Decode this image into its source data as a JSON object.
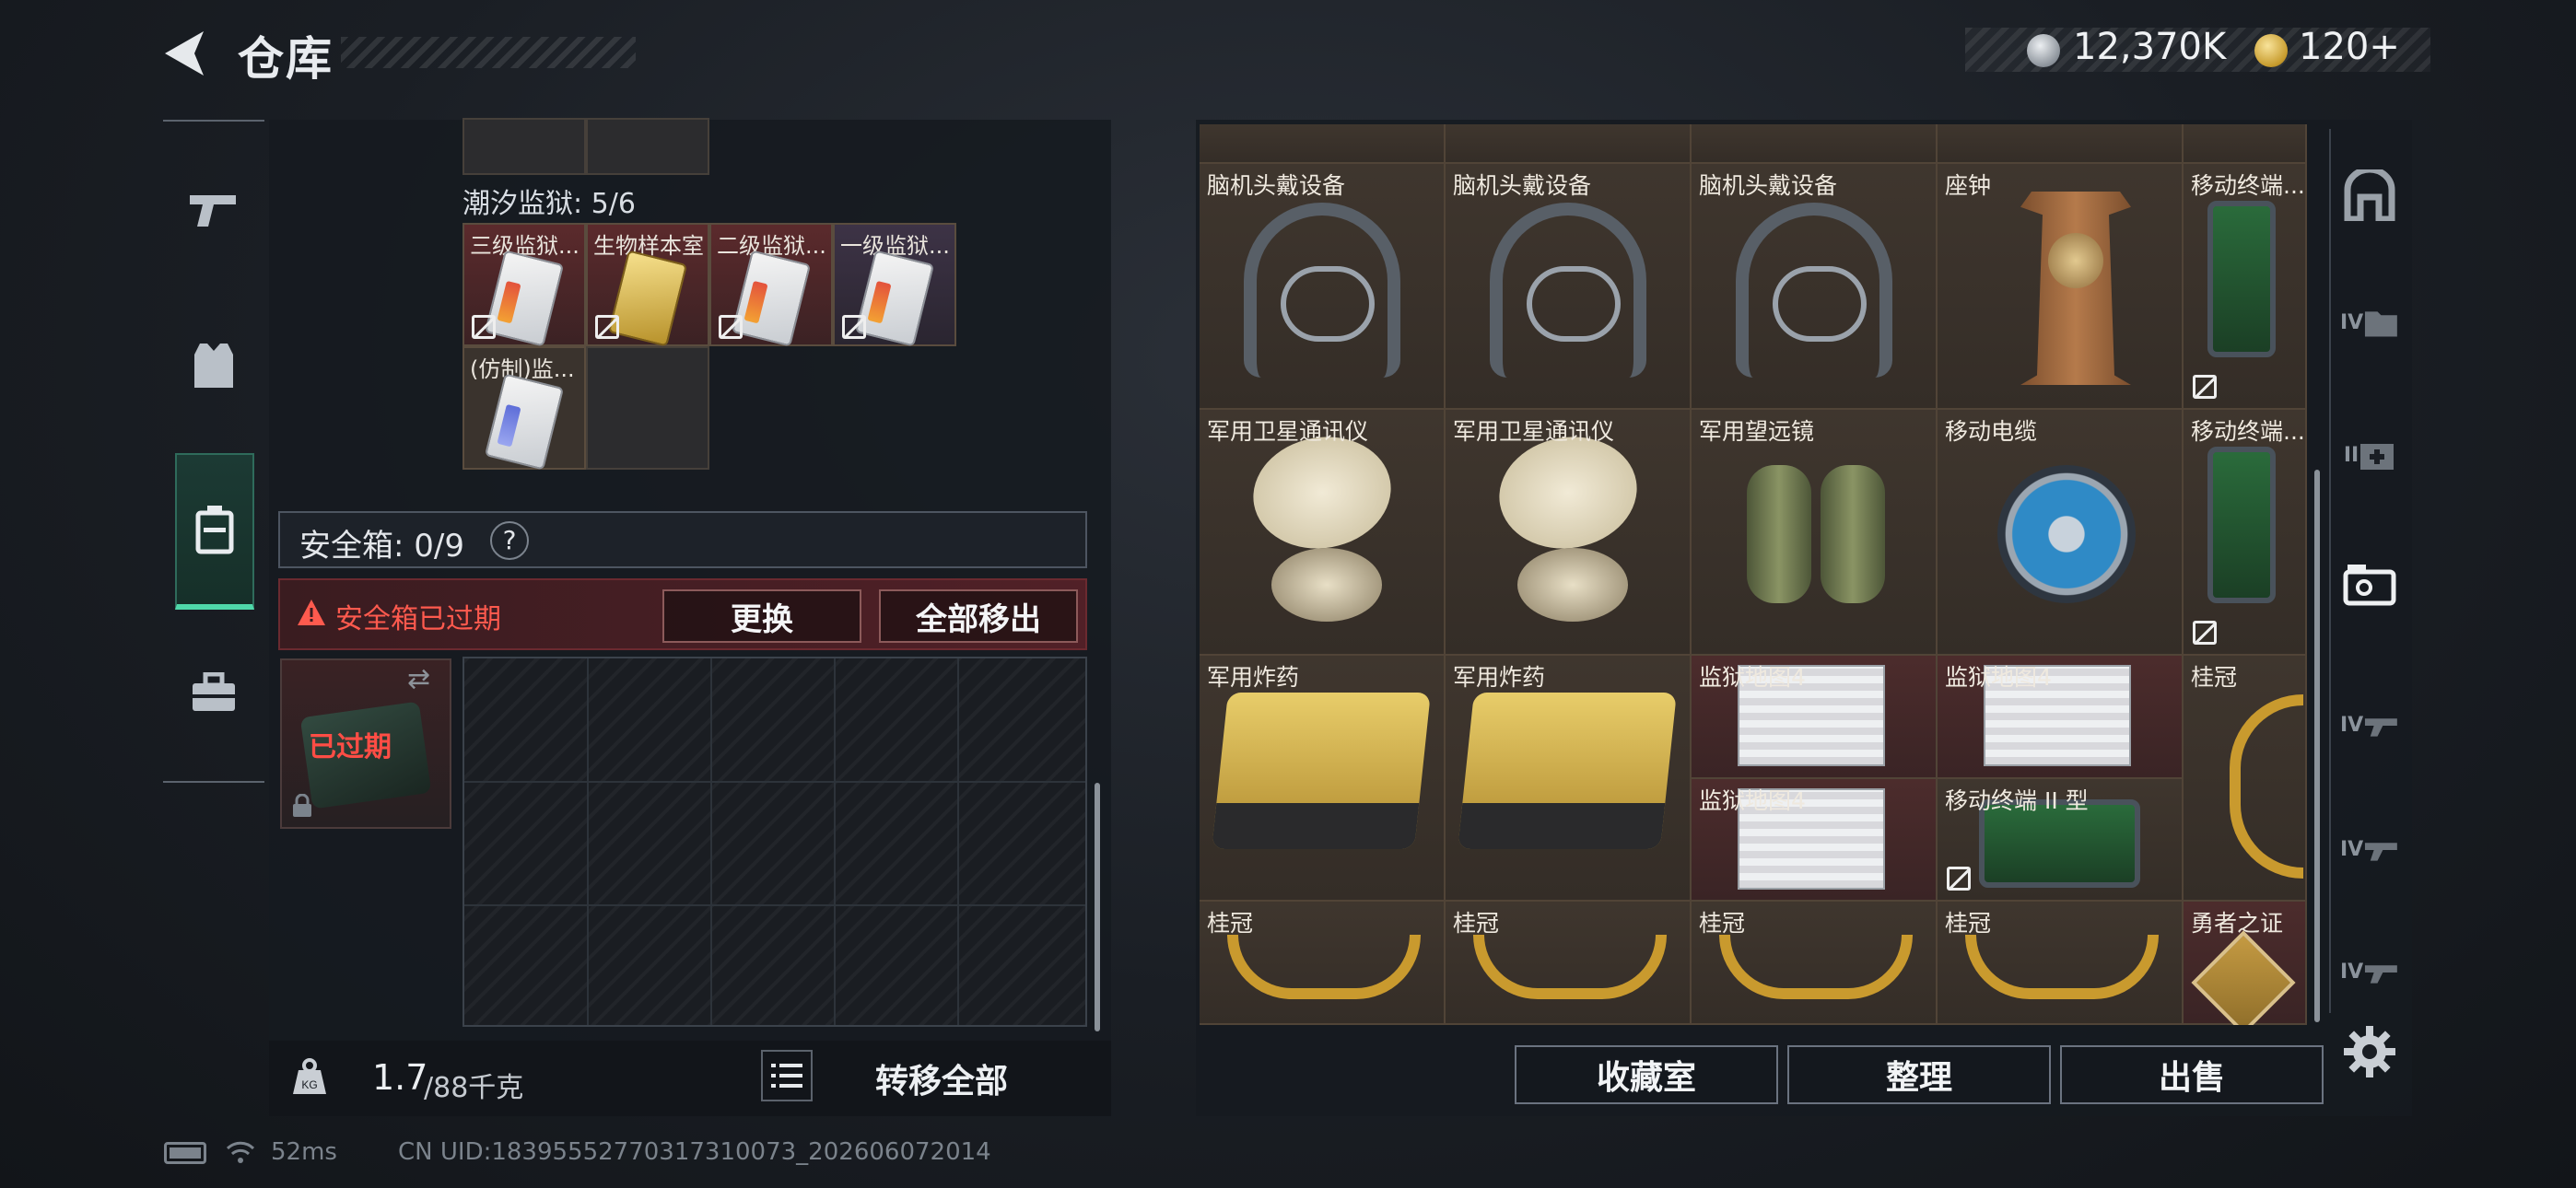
{
  "header": {
    "title": "仓库",
    "silver": "12,370K",
    "gold": "120+"
  },
  "nav": {
    "items": [
      {
        "name": "weapon",
        "icon": "pistol-icon"
      },
      {
        "name": "armor",
        "icon": "armor-vest-icon"
      },
      {
        "name": "case",
        "icon": "case-icon",
        "active": true
      },
      {
        "name": "kit",
        "icon": "toolbox-icon"
      }
    ]
  },
  "left": {
    "prison_title": "潮汐监狱: 5/6",
    "prison_items": [
      {
        "label": "三级监狱...",
        "bg": "red"
      },
      {
        "label": "生物样本室",
        "bg": "red"
      },
      {
        "label": "二级监狱...",
        "bg": "red"
      },
      {
        "label": "一级监狱...",
        "bg": "purple"
      },
      {
        "label": "(仿制)监...",
        "bg": "plain"
      }
    ],
    "safe_title": "安全箱: 0/9",
    "safe_help": "?",
    "expired_text": "安全箱已过期",
    "replace_label": "更换",
    "moveall_label": "全部移出",
    "case_expired": "已过期",
    "weight_value": "1.7",
    "weight_max": "/88千克",
    "transfer_all": "转移全部"
  },
  "right": {
    "items": [
      {
        "label": "脑机头戴设备",
        "art": "headset"
      },
      {
        "label": "脑机头戴设备",
        "art": "headset"
      },
      {
        "label": "脑机头戴设备",
        "art": "headset"
      },
      {
        "label": "座钟",
        "art": "clock"
      },
      {
        "label": "移动终端...",
        "art": "terminal"
      },
      {
        "label": "军用卫星通讯仪",
        "art": "satellite"
      },
      {
        "label": "军用卫星通讯仪",
        "art": "satellite"
      },
      {
        "label": "军用望远镜",
        "art": "binoc"
      },
      {
        "label": "移动电缆",
        "art": "reel"
      },
      {
        "label": "移动终端...",
        "art": "terminal"
      },
      {
        "label": "军用炸药",
        "art": "explosive"
      },
      {
        "label": "军用炸药",
        "art": "explosive"
      },
      {
        "label": "监狱地图4",
        "art": "map"
      },
      {
        "label": "监狱地图4",
        "art": "map"
      },
      {
        "label": "桂冠",
        "art": "wreath-v"
      },
      {
        "label": "监狱地图4",
        "art": "map"
      },
      {
        "label": "移动终端 II 型",
        "art": "terminal-wide"
      },
      {
        "label": "桂冠",
        "art": "wreath"
      },
      {
        "label": "桂冠",
        "art": "wreath"
      },
      {
        "label": "桂冠",
        "art": "wreath"
      },
      {
        "label": "桂冠",
        "art": "wreath"
      },
      {
        "label": "勇者之证",
        "art": "badge"
      }
    ],
    "collect_label": "收藏室",
    "sort_label": "整理",
    "sell_label": "出售",
    "tabs": [
      {
        "name": "shelter-tab",
        "text": ""
      },
      {
        "name": "level4-folder-tab",
        "text": "IV"
      },
      {
        "name": "level2-medkit-tab",
        "text": "II"
      },
      {
        "name": "ticket-tab",
        "text": ""
      },
      {
        "name": "level4-gun-tab-1",
        "text": "IV"
      },
      {
        "name": "level4-gun-tab-2",
        "text": "IV"
      },
      {
        "name": "level4-gun-tab-3",
        "text": "IV"
      }
    ]
  },
  "footer": {
    "ping": "52ms",
    "uid": "CN UID:18395552770317310073_202606072014"
  },
  "colors": {
    "accent_green": "#4fd8a9",
    "expired_red": "#ff5a4e",
    "cell_brown": "#3a332c"
  }
}
